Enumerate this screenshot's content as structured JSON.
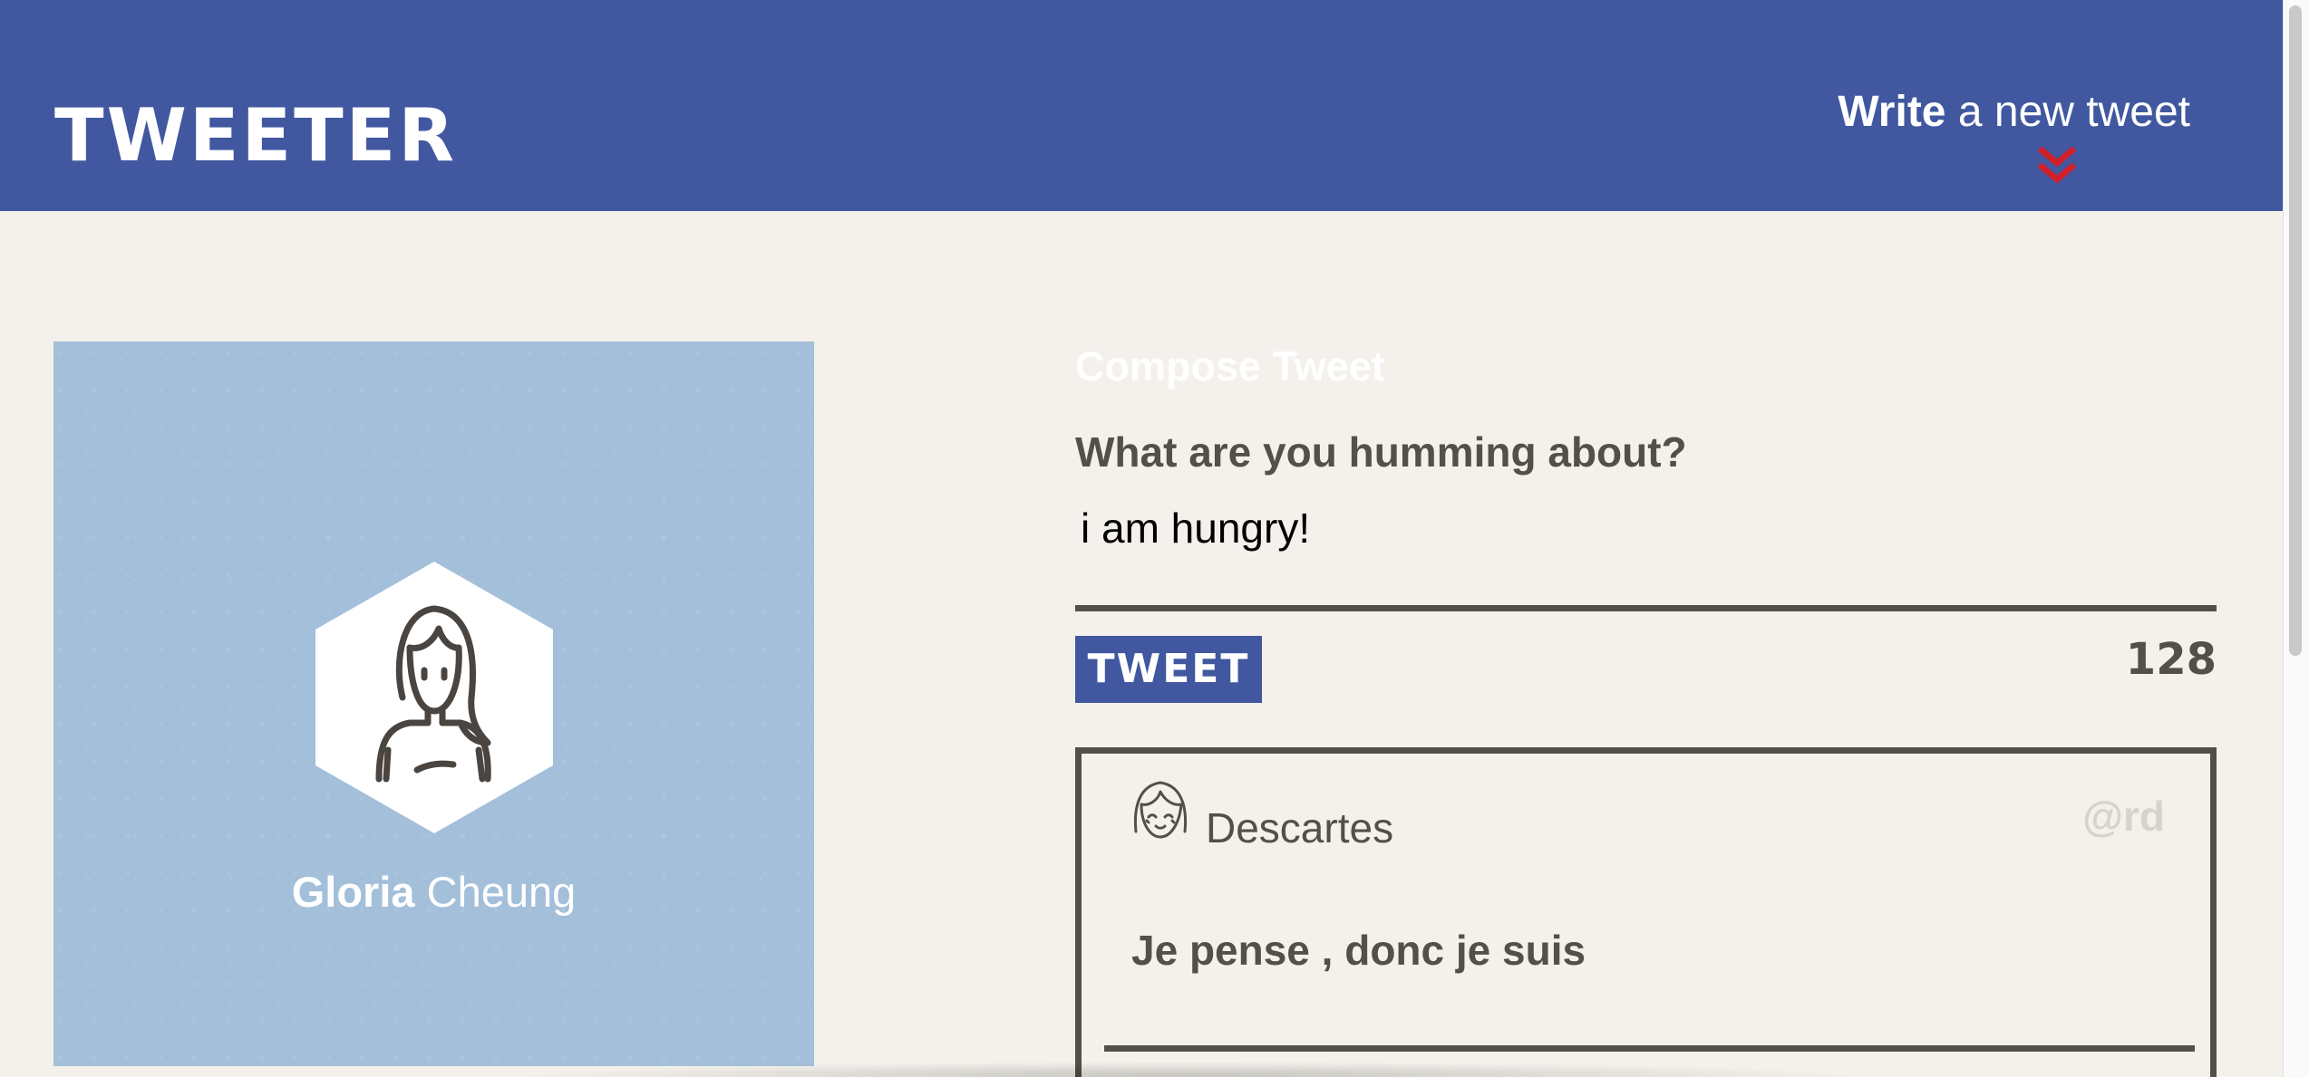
{
  "header": {
    "brand": "TWEETER",
    "write_link": {
      "strong": "Write",
      "rest": "a new tweet"
    },
    "arrow_icon": "double-chevron-down-icon",
    "background_color": "#4158a0",
    "arrow_color": "#d0202b"
  },
  "profile": {
    "first_name": "Gloria",
    "last_name": "Cheung",
    "avatar_icon": "person-avatar-icon",
    "background_color": "#a3bfda"
  },
  "compose": {
    "title": "Compose Tweet",
    "label": "What are you humming about?",
    "input_value": "i am hungry!",
    "button_label": "TWEET",
    "char_counter": "128"
  },
  "tweets": [
    {
      "author": "Descartes",
      "handle": "@rd",
      "text": "Je pense , donc je suis",
      "avatar_icon": "smiling-face-avatar-icon"
    }
  ],
  "colors": {
    "page_background": "#f4f1ec",
    "text_dark": "#545048",
    "handle_light": "#d6d3ce"
  }
}
